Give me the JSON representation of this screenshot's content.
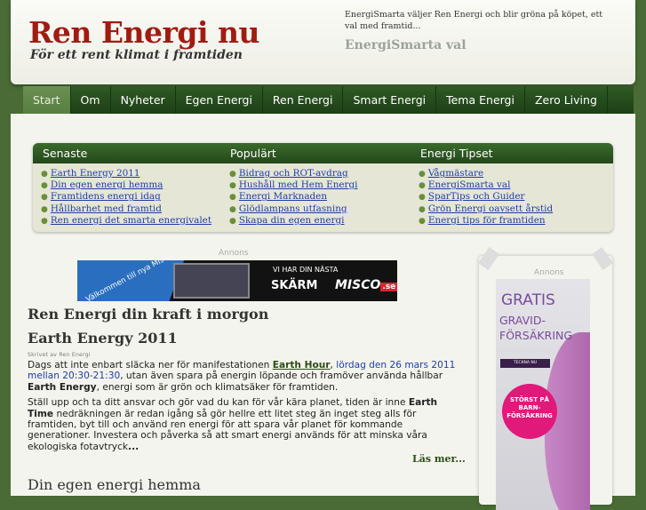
{
  "header": {
    "site_title": "Ren Energi nu",
    "tagline": "För ett rent klimat i framtiden",
    "promo_text": "EnergiSmarta väljer Ren Energi och blir gröna på köpet, ett val med framtid...",
    "promo_title": "EnergiSmarta val"
  },
  "nav": [
    {
      "label": "Start"
    },
    {
      "label": "Om"
    },
    {
      "label": "Nyheter"
    },
    {
      "label": "Egen Energi"
    },
    {
      "label": "Ren Energi"
    },
    {
      "label": "Smart Energi"
    },
    {
      "label": "Tema Energi"
    },
    {
      "label": "Zero Living"
    }
  ],
  "widget": {
    "columns": [
      {
        "title": "Senaste",
        "items": [
          "Earth Energy 2011",
          "Din egen energi hemma",
          "Framtidens energi idag",
          "Hållbarhet med framtid",
          "Ren energi det smarta energivalet"
        ]
      },
      {
        "title": "Populärt",
        "items": [
          "Bidrag och ROT-avdrag",
          "Hushåll med Hem Energi",
          "Energi Marknaden",
          "Glödlampans utfasning",
          "Skapa din egen energi"
        ]
      },
      {
        "title": "Energi Tipset",
        "items": [
          "Vågmästare",
          "EnergiSmarta val",
          "SparTips och Guider",
          "Grön Energi oavsett årstid",
          "Energi tips för framtiden"
        ]
      }
    ]
  },
  "ads": {
    "label": "Annons",
    "banner": {
      "welcome": "Välkommen till nya Misco!",
      "line1": "VI HAR DIN NÄSTA",
      "line2": "SKÄRM",
      "logo": "MISCO",
      "logo_tld": ".se"
    },
    "side": {
      "title": "GRATIS",
      "subtitle": "GRAVID-FÖRSÄKRING",
      "button": "TECKNA NU",
      "badge": "STÖRST PÅ BARN-FÖRSÄKRING"
    }
  },
  "main": {
    "section_title": "Ren Energi din kraft i morgon",
    "post_title": "Earth Energy 2011",
    "byline": "Skrivet av Ren Energi",
    "p1_a": "Dags att inte enbart släcka ner för manifestationen ",
    "p1_link": "Earth Hour",
    "p1_b": ", ",
    "p1_date": "lördag den 26 mars 2011 mellan 20:30-21:30",
    "p1_c": ", utan även spara på energin löpande och framöver använda hållbar ",
    "p1_strong": "Earth Energy",
    "p1_d": ", energi som är  grön och klimatsäker för framtiden.",
    "p2_a": "Ställ upp och ta ditt ansvar och gör vad du kan för vår kära planet, tiden är inne ",
    "p2_strong": "Earth Time",
    "p2_b": " nedräkningen är redan igång så gör hellre ett litet steg än inget steg alls för framtiden, byt till och använd ren energi för att spara vår planet för kommande generationer. Investera och påverka så att smart energi används för att minska våra ekologiska fotavtryck",
    "p2_more": "...",
    "read_more": "Läs mer...",
    "next_post_title": "Din egen energi hemma"
  }
}
